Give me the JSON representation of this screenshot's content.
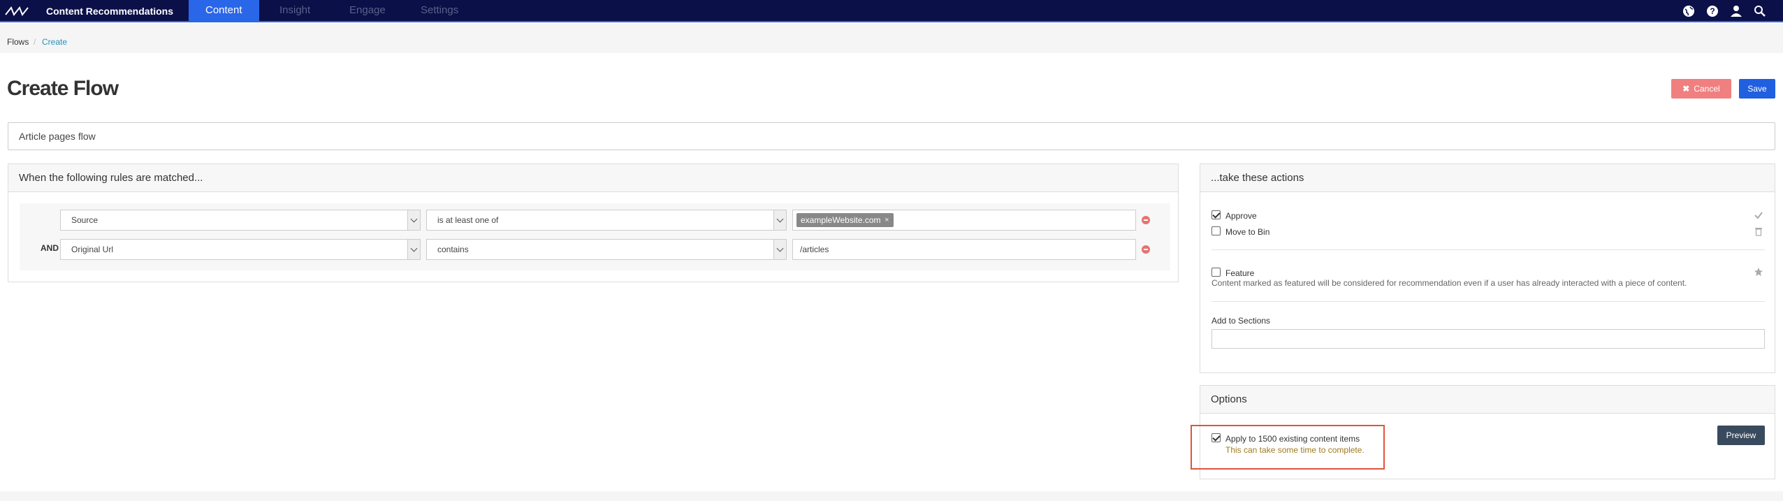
{
  "app": {
    "brand": "Content Recommendations"
  },
  "nav": {
    "tabs": [
      "Content",
      "Insight",
      "Engage",
      "Settings"
    ]
  },
  "breadcrumb": {
    "root": "Flows",
    "separator": "/",
    "current": "Create"
  },
  "page": {
    "title": "Create Flow"
  },
  "actions": {
    "cancel_label": "Cancel",
    "save_label": "Save"
  },
  "flow": {
    "name_value": "Article pages flow"
  },
  "rules": {
    "heading": "When the following rules are matched...",
    "rows": [
      {
        "connector": "",
        "field": "Source",
        "operator": "is at least one of",
        "tag": "exampleWebsite.com",
        "tag_remove": "×"
      },
      {
        "connector": "AND",
        "field": "Original Url",
        "operator": "contains",
        "value": "/articles"
      }
    ]
  },
  "actions_panel": {
    "heading": "...take these actions",
    "approve": "Approve",
    "move_to_bin": "Move to Bin",
    "feature": "Feature",
    "feature_desc": "Content marked as featured will be considered for recommendation even if a user has already interacted with a piece of content.",
    "add_to_sections": "Add to Sections"
  },
  "options": {
    "heading": "Options",
    "apply_prefix": "Apply to",
    "apply_count": "1500",
    "apply_suffix": "existing content items",
    "apply_note": "This can take some time to complete.",
    "preview_label": "Preview"
  },
  "colors": {
    "nav_bg": "#0b1048",
    "accent": "#2a66e8",
    "cancel": "#f08080",
    "warn_text": "#a07a20"
  }
}
